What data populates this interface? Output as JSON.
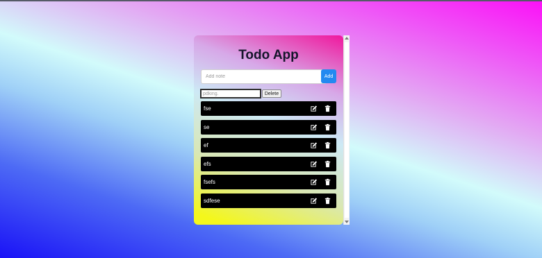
{
  "app": {
    "title": "Todo App"
  },
  "new_note": {
    "placeholder": "Add note",
    "add_label": "Add"
  },
  "edit_bar": {
    "input_placeholder": "pdking.",
    "delete_label": "Delete"
  },
  "todos": [
    {
      "text": "fse",
      "edit_icon": "edit-icon",
      "delete_icon": "trash-icon"
    },
    {
      "text": "se",
      "edit_icon": "edit-icon",
      "delete_icon": "trash-icon"
    },
    {
      "text": "ef",
      "edit_icon": "edit-icon",
      "delete_icon": "trash-icon"
    },
    {
      "text": "efs",
      "edit_icon": "edit-icon",
      "delete_icon": "trash-icon"
    },
    {
      "text": "fsefs",
      "edit_icon": "edit-icon",
      "delete_icon": "trash-icon"
    },
    {
      "text": "sdfese",
      "edit_icon": "edit-icon",
      "delete_icon": "trash-icon"
    }
  ],
  "colors": {
    "add_button": "#2389f0",
    "item_background": "#000000",
    "item_text": "#ffffff",
    "title": "#15152b"
  }
}
